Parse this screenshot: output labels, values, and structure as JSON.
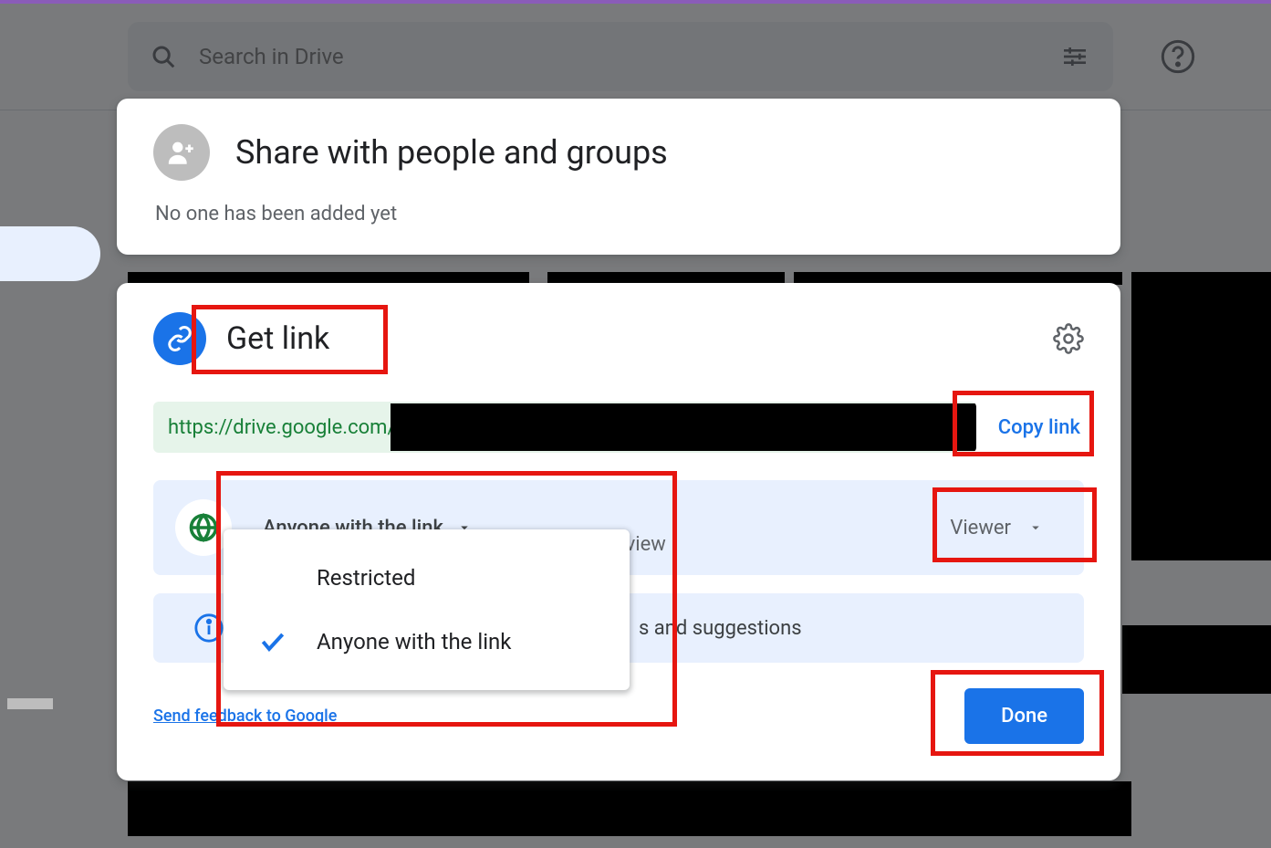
{
  "search": {
    "placeholder": "Search in Drive"
  },
  "share": {
    "title": "Share with people and groups",
    "subtitle": "No one has been added yet"
  },
  "link": {
    "title": "Get link",
    "url_visible": "https://drive.google.com/",
    "copy_label": "Copy link",
    "access_selected": "Anyone with the link",
    "view_fragment": "n view",
    "permission": "Viewer",
    "options": {
      "restricted": "Restricted",
      "anyone": "Anyone with the link"
    },
    "info_fragment": "s and suggestions",
    "feedback": "Send feedback to Google",
    "done": "Done"
  }
}
